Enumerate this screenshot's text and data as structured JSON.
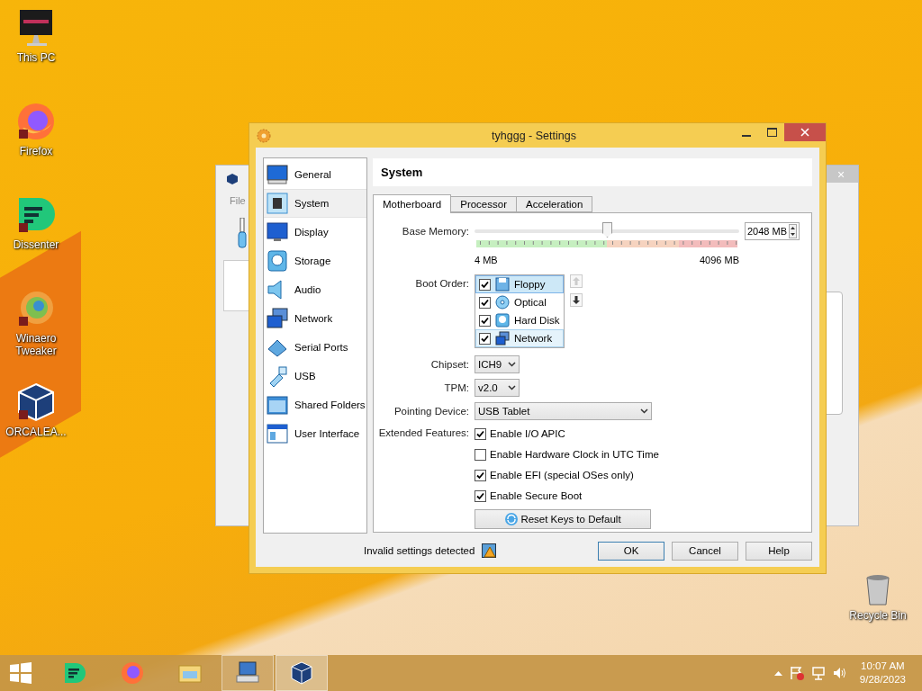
{
  "desktop_icons": [
    {
      "kind": "pc",
      "label": "This PC"
    },
    {
      "kind": "firefox",
      "label": "Firefox"
    },
    {
      "kind": "dissenter",
      "label": "Dissenter"
    },
    {
      "kind": "tweaker",
      "label": "Winaero Tweaker"
    },
    {
      "kind": "vbox",
      "label": "ORCALEA..."
    },
    {
      "kind": "bin",
      "label": "Recycle Bin"
    }
  ],
  "background_window": {
    "menu": "File",
    "close": "×"
  },
  "dialog": {
    "title": "tyhggg - Settings",
    "sidebar": [
      {
        "kind": "general",
        "label": "General",
        "selected": false
      },
      {
        "kind": "system",
        "label": "System",
        "selected": true
      },
      {
        "kind": "display",
        "label": "Display",
        "selected": false
      },
      {
        "kind": "storage",
        "label": "Storage",
        "selected": false
      },
      {
        "kind": "audio",
        "label": "Audio",
        "selected": false
      },
      {
        "kind": "network",
        "label": "Network",
        "selected": false
      },
      {
        "kind": "serial",
        "label": "Serial Ports",
        "selected": false
      },
      {
        "kind": "usb",
        "label": "USB",
        "selected": false
      },
      {
        "kind": "folders",
        "label": "Shared Folders",
        "selected": false
      },
      {
        "kind": "ui",
        "label": "User Interface",
        "selected": false
      }
    ],
    "section_title": "System",
    "tabs": [
      {
        "label": "Motherboard",
        "selected": true
      },
      {
        "label": "Processor",
        "selected": false
      },
      {
        "label": "Acceleration",
        "selected": false
      }
    ],
    "base_memory": {
      "label": "Base Memory:",
      "level": 0.5,
      "value": "2048 MB",
      "min_label": "4 MB",
      "max_label": "4096 MB"
    },
    "boot_order": {
      "label": "Boot Order:",
      "items": [
        {
          "kind": "floppy",
          "label": "Floppy",
          "checked": true,
          "selected": true,
          "hovered": false
        },
        {
          "kind": "optical",
          "label": "Optical",
          "checked": true,
          "selected": false,
          "hovered": false
        },
        {
          "kind": "harddisk",
          "label": "Hard Disk",
          "checked": true,
          "selected": false,
          "hovered": false
        },
        {
          "kind": "network",
          "label": "Network",
          "checked": true,
          "selected": false,
          "hovered": true
        }
      ]
    },
    "selects": [
      {
        "label": "Chipset:",
        "value": "ICH9",
        "kind": "compact"
      },
      {
        "label": "TPM:",
        "value": "v2.0",
        "kind": "compact"
      },
      {
        "label": "Pointing Device:",
        "value": "USB Tablet",
        "kind": "wide"
      }
    ],
    "extended_features": {
      "label": "Extended Features:",
      "options": [
        {
          "label": "Enable I/O APIC",
          "checked": true
        },
        {
          "label": "Enable Hardware Clock in UTC Time",
          "checked": false
        },
        {
          "label": "Enable EFI (special OSes only)",
          "checked": true
        },
        {
          "label": "Enable Secure Boot",
          "checked": true
        }
      ]
    },
    "reset_button": "Reset Keys to Default",
    "status": "Invalid settings detected",
    "buttons": [
      {
        "label": "OK",
        "default": true
      },
      {
        "label": "Cancel",
        "default": false
      },
      {
        "label": "Help",
        "default": false
      }
    ]
  },
  "taskbar": {
    "apps": [
      {
        "kind": "start",
        "active": false,
        "open": false
      },
      {
        "kind": "dissenter",
        "active": false,
        "open": false
      },
      {
        "kind": "firefox",
        "active": false,
        "open": false
      },
      {
        "kind": "explorer",
        "active": false,
        "open": false
      },
      {
        "kind": "pc",
        "active": false,
        "open": true
      },
      {
        "kind": "vbox",
        "active": true,
        "open": true
      }
    ],
    "time": "10:07 AM",
    "date": "9/28/2023"
  }
}
